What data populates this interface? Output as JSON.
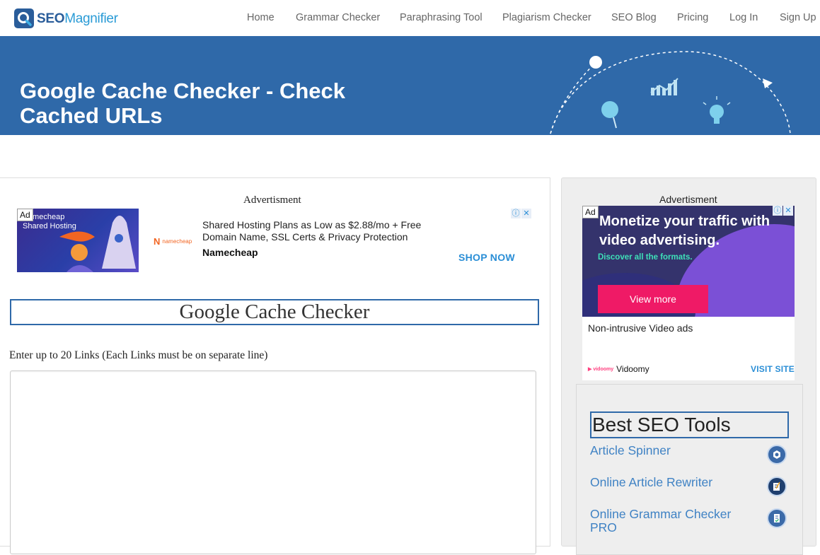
{
  "header": {
    "logo": {
      "seo": "SEO",
      "magnifier": "Magnifier"
    },
    "nav": [
      "Home",
      "Grammar Checker",
      "Paraphrasing Tool",
      "Plagiarism Checker",
      "SEO Blog",
      "Pricing",
      "Log In",
      "Sign Up"
    ]
  },
  "banner": {
    "title": "Google Cache Checker - Check Cached URLs"
  },
  "main": {
    "ad_caption": "Advertisment",
    "ad": {
      "badge": "Ad",
      "image_text": "Namecheap Shared Hosting",
      "advertiser_logo_text": "namecheap",
      "body": "Shared Hosting Plans as Low as $2.88/mo + Free Domain Name, SSL Certs & Privacy Protection",
      "brand": "Namecheap",
      "cta": "SHOP NOW"
    },
    "tool_title": "Google Cache Checker",
    "instruction": "Enter up to 20 Links (Each Links must be on separate line)",
    "textarea_value": ""
  },
  "sidebar": {
    "ad_caption": "Advertisment",
    "ad": {
      "badge": "Ad",
      "headline": "Monetize your traffic with video advertising.",
      "subline": "Discover all the formats.",
      "button": "View more",
      "description": "Non-intrusive Video ads",
      "brand_logo": "vidoomy",
      "brand": "Vidoomy",
      "cta": "VISIT SITE"
    },
    "best_tools": {
      "title": "Best SEO Tools",
      "items": [
        {
          "label": "Article Spinner",
          "icon": "spinner-tool-icon"
        },
        {
          "label": "Online Article Rewriter",
          "icon": "rewriter-tool-icon"
        },
        {
          "label": "Online Grammar Checker PRO",
          "icon": "grammar-tool-icon"
        }
      ]
    }
  },
  "colors": {
    "brand_blue": "#2f69a9",
    "link_blue": "#3f82c4",
    "ad_cta_blue": "#2a8ed6",
    "ad_button_pink": "#ef1a66"
  }
}
